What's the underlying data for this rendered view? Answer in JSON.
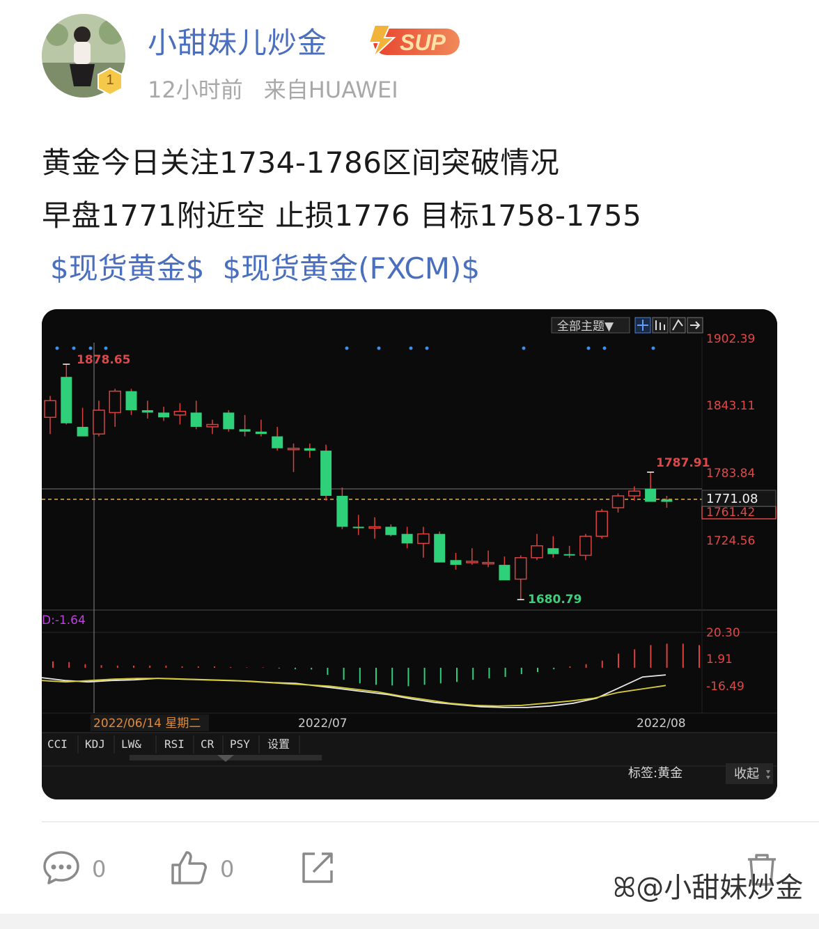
{
  "author": {
    "name": "小甜妹儿炒金",
    "rank": "1",
    "badge_text": "SUP",
    "time": "12小时前",
    "source": "来自HUAWEI"
  },
  "post": {
    "line1": "黄金今日关注1734-1786区间突破情况",
    "line2": "早盘1771附近空 止损1776 目标1758-1755",
    "tags": [
      "$现货黄金$",
      "$现货黄金(FXCM)$"
    ]
  },
  "chart": {
    "toolbar_label": "全部主题▼",
    "price_labels": [
      "1902.39",
      "1843.11",
      "1783.84",
      "1724.56"
    ],
    "current_price": "1771.08",
    "second_price": "1761.42",
    "high_label": "1878.65",
    "low_label": "1680.79",
    "recent_high_label": "1787.91",
    "indicator_readout": "D:-1.64",
    "indicator_labels": [
      "20.30",
      "1.91",
      "-16.49"
    ],
    "date_labels": [
      "2022/06/14 星期二",
      "2022/07",
      "2022/08"
    ],
    "indicator_tabs": [
      "CCI",
      "KDJ",
      "LW&",
      "RSI",
      "CR",
      "PSY",
      "设置"
    ],
    "tag_label": "标签:黄金",
    "collapse_label": "收起"
  },
  "chart_data": {
    "type": "candlestick",
    "symbol": "现货黄金",
    "y_axis_ticks": [
      1902.39,
      1843.11,
      1783.84,
      1724.56
    ],
    "y_range": [
      1672,
      1905
    ],
    "current_price": 1771.08,
    "annotations": {
      "max": 1878.65,
      "min": 1680.79,
      "recent_high": 1787.91
    },
    "candles": [
      {
        "o": 1834,
        "h": 1852,
        "l": 1820,
        "c": 1848
      },
      {
        "o": 1868,
        "h": 1878.65,
        "l": 1828,
        "c": 1829
      },
      {
        "o": 1826,
        "h": 1842,
        "l": 1820,
        "c": 1818
      },
      {
        "o": 1820,
        "h": 1848,
        "l": 1818,
        "c": 1840
      },
      {
        "o": 1838,
        "h": 1858,
        "l": 1826,
        "c": 1856
      },
      {
        "o": 1856,
        "h": 1858,
        "l": 1836,
        "c": 1840
      },
      {
        "o": 1840,
        "h": 1848,
        "l": 1833,
        "c": 1838
      },
      {
        "o": 1838,
        "h": 1843,
        "l": 1831,
        "c": 1834
      },
      {
        "o": 1836,
        "h": 1846,
        "l": 1828,
        "c": 1839
      },
      {
        "o": 1838,
        "h": 1848,
        "l": 1824,
        "c": 1826
      },
      {
        "o": 1826,
        "h": 1832,
        "l": 1820,
        "c": 1828
      },
      {
        "o": 1838,
        "h": 1840,
        "l": 1822,
        "c": 1824
      },
      {
        "o": 1824,
        "h": 1836,
        "l": 1818,
        "c": 1822
      },
      {
        "o": 1822,
        "h": 1832,
        "l": 1818,
        "c": 1820
      },
      {
        "o": 1818,
        "h": 1826,
        "l": 1806,
        "c": 1808
      },
      {
        "o": 1808,
        "h": 1812,
        "l": 1788,
        "c": 1808
      },
      {
        "o": 1808,
        "h": 1812,
        "l": 1800,
        "c": 1806
      },
      {
        "o": 1806,
        "h": 1811,
        "l": 1764,
        "c": 1768
      },
      {
        "o": 1768,
        "h": 1775,
        "l": 1740,
        "c": 1742
      },
      {
        "o": 1742,
        "h": 1752,
        "l": 1735,
        "c": 1741
      },
      {
        "o": 1742,
        "h": 1750,
        "l": 1732,
        "c": 1742
      },
      {
        "o": 1742,
        "h": 1744,
        "l": 1734,
        "c": 1735
      },
      {
        "o": 1736,
        "h": 1742,
        "l": 1724,
        "c": 1728
      },
      {
        "o": 1728,
        "h": 1742,
        "l": 1716,
        "c": 1736
      },
      {
        "o": 1736,
        "h": 1738,
        "l": 1712,
        "c": 1712
      },
      {
        "o": 1714,
        "h": 1720,
        "l": 1706,
        "c": 1710
      },
      {
        "o": 1712,
        "h": 1724,
        "l": 1710,
        "c": 1713
      },
      {
        "o": 1712,
        "h": 1722,
        "l": 1708,
        "c": 1712
      },
      {
        "o": 1710,
        "h": 1717,
        "l": 1698,
        "c": 1697
      },
      {
        "o": 1698,
        "h": 1718,
        "l": 1680.79,
        "c": 1716
      },
      {
        "o": 1716,
        "h": 1736,
        "l": 1714,
        "c": 1726
      },
      {
        "o": 1724,
        "h": 1734,
        "l": 1716,
        "c": 1719
      },
      {
        "o": 1719,
        "h": 1726,
        "l": 1716,
        "c": 1718
      },
      {
        "o": 1718,
        "h": 1736,
        "l": 1714,
        "c": 1734
      },
      {
        "o": 1734,
        "h": 1757,
        "l": 1732,
        "c": 1755
      },
      {
        "o": 1758,
        "h": 1770,
        "l": 1754,
        "c": 1768
      },
      {
        "o": 1768,
        "h": 1776,
        "l": 1764,
        "c": 1772
      },
      {
        "o": 1774,
        "h": 1787.91,
        "l": 1771,
        "c": 1763
      },
      {
        "o": 1765,
        "h": 1768,
        "l": 1758,
        "c": 1763
      }
    ],
    "indicator": {
      "name": "MACD",
      "D": -1.64,
      "y_axis_ticks": [
        20.3,
        1.91,
        -16.49
      ],
      "y_range": [
        -32,
        25
      ],
      "histogram": [
        4.5,
        4,
        2.5,
        1.8,
        1.5,
        1.5,
        1.5,
        1.5,
        1,
        1,
        1,
        0.5,
        0.3,
        0.3,
        -0.5,
        -1,
        -1.2,
        -5,
        -8.5,
        -11,
        -12,
        -12.5,
        -13,
        -12,
        -11,
        -10,
        -8.5,
        -7.5,
        -6.5,
        -4.5,
        -3,
        -1,
        1,
        2.5,
        5,
        10,
        13,
        16,
        17,
        17,
        16
      ],
      "dif": [
        -7,
        -9,
        -10,
        -9,
        -8.5,
        -7.5,
        -8,
        -8.5,
        -9,
        -9.5,
        -10.5,
        -11,
        -13,
        -15,
        -17,
        -19,
        -22,
        -24.5,
        -26,
        -27.5,
        -28,
        -28,
        -27,
        -25,
        -21.5,
        -14,
        -6.5,
        -5
      ],
      "dea": [
        -9,
        -10,
        -9,
        -8,
        -7.5,
        -7.5,
        -8,
        -8.5,
        -9,
        -10,
        -11,
        -12,
        -13,
        -15,
        -17,
        -20,
        -22.5,
        -25,
        -26.5,
        -27,
        -26.5,
        -25,
        -23.5,
        -21.5,
        -17.5,
        -15,
        -12.5
      ]
    },
    "x_labels": [
      "2022/06/14 星期二",
      "2022/07",
      "2022/08"
    ]
  }
}
